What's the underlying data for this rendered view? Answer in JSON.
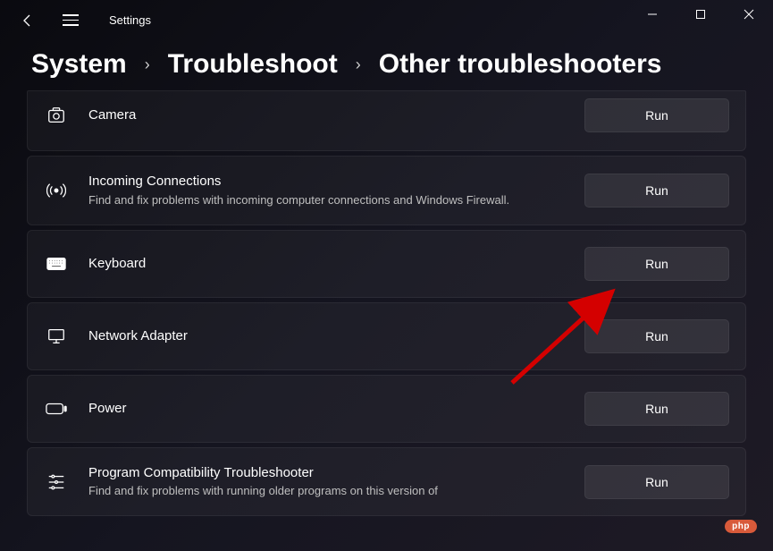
{
  "app": {
    "title": "Settings"
  },
  "breadcrumb": {
    "item1": "System",
    "item2": "Troubleshoot",
    "item3": "Other troubleshooters"
  },
  "run_label": "Run",
  "items": [
    {
      "title": "Camera",
      "desc": ""
    },
    {
      "title": "Incoming Connections",
      "desc": "Find and fix problems with incoming computer connections and Windows Firewall."
    },
    {
      "title": "Keyboard",
      "desc": ""
    },
    {
      "title": "Network Adapter",
      "desc": ""
    },
    {
      "title": "Power",
      "desc": ""
    },
    {
      "title": "Program Compatibility Troubleshooter",
      "desc": "Find and fix problems with running older programs on this version of"
    }
  ],
  "watermark": "php"
}
